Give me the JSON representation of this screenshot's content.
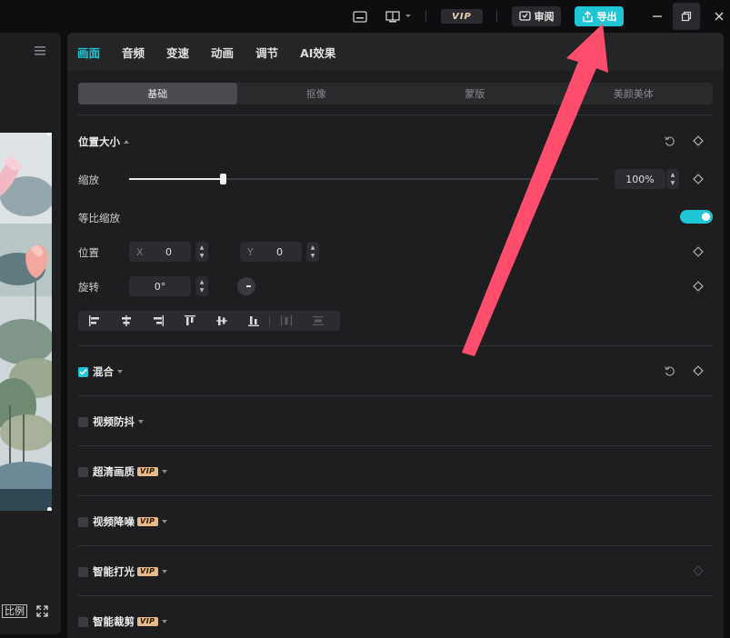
{
  "titlebar": {
    "vip_label": "VIP",
    "review_label": "审阅",
    "export_label": "导出",
    "accent_color": "#1fc6d6"
  },
  "left_panel": {
    "ratio_label": "比例"
  },
  "tabs": [
    "画面",
    "音频",
    "变速",
    "动画",
    "调节",
    "AI效果"
  ],
  "active_tab": "画面",
  "subtabs": [
    "基础",
    "抠像",
    "蒙版",
    "美颜美体"
  ],
  "active_subtab": "基础",
  "position_size": {
    "title": "位置大小",
    "scale_label": "缩放",
    "scale_value": "100%",
    "scale_slider_fraction": 0.2,
    "uniform_scale_label": "等比缩放",
    "uniform_scale_on": true,
    "position_label": "位置",
    "x_prefix": "X",
    "x_value": "0",
    "y_prefix": "Y",
    "y_value": "0",
    "rotate_label": "旋转",
    "rotate_value": "0°"
  },
  "sections": [
    {
      "label": "混合",
      "checked": true,
      "vip": false
    },
    {
      "label": "视频防抖",
      "checked": false,
      "vip": false
    },
    {
      "label": "超清画质",
      "checked": false,
      "vip": true
    },
    {
      "label": "视频降噪",
      "checked": false,
      "vip": true
    },
    {
      "label": "智能打光",
      "checked": false,
      "vip": true
    },
    {
      "label": "智能裁剪",
      "checked": false,
      "vip": true
    }
  ],
  "vip_tag": "VIP",
  "annotation_arrow_color": "#ff4d6d"
}
